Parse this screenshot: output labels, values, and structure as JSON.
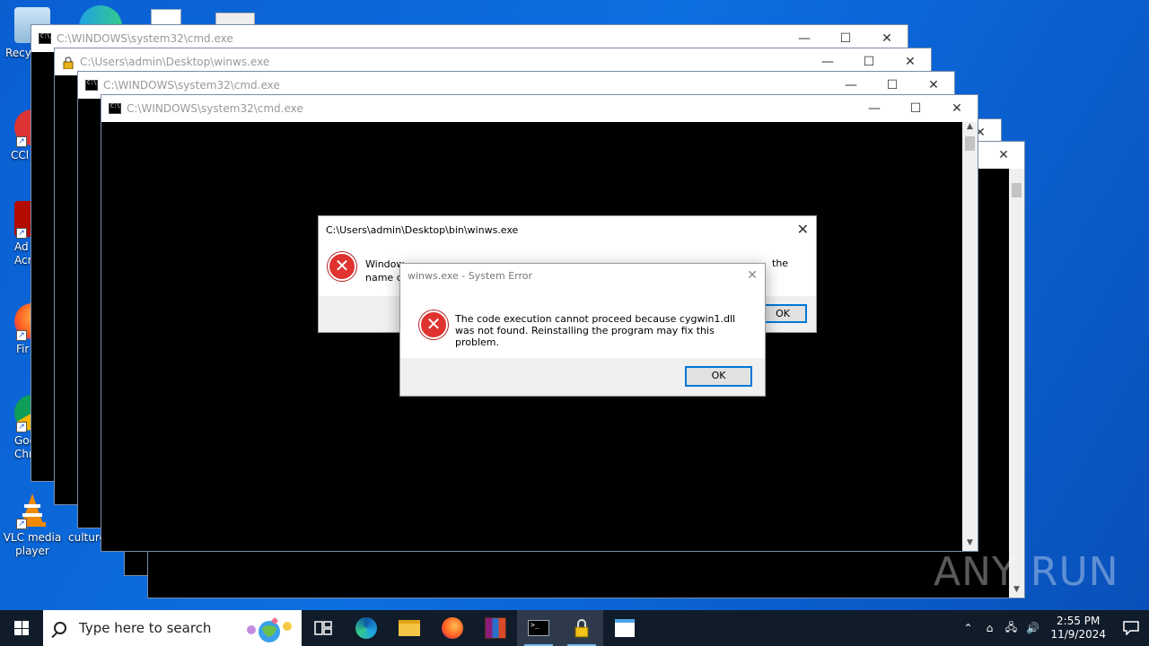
{
  "desktop": {
    "icons": [
      {
        "label": "Recy"
      },
      {
        "label": "CCl"
      },
      {
        "label": "Ad Acr"
      },
      {
        "label": "Fir"
      },
      {
        "label": "Goo Chr"
      },
      {
        "label": "VLC media player"
      },
      {
        "label": "culture"
      }
    ]
  },
  "windows": [
    {
      "title": "C:\\WINDOWS\\system32\\cmd.exe"
    },
    {
      "title": "C:\\Users\\admin\\Desktop\\winws.exe"
    },
    {
      "title": "C:\\WINDOWS\\system32\\cmd.exe"
    },
    {
      "title": "C:\\WINDOWS\\system32\\cmd.exe"
    }
  ],
  "controls": {
    "minimize": "—",
    "maximize": "☐",
    "close": "✕"
  },
  "dialog_back": {
    "title": "C:\\Users\\admin\\Desktop\\bin\\winws.exe",
    "message_line1": "Window",
    "message_line1_end": "the",
    "message_line2": "name c",
    "ok": "OK"
  },
  "dialog_front": {
    "title": "winws.exe - System Error",
    "message": "The code execution cannot proceed because cygwin1.dll was not found. Reinstalling the program may fix this problem.",
    "ok": "OK"
  },
  "watermark": "ANY RUN",
  "taskbar": {
    "search_placeholder": "Type here to search",
    "time": "2:55 PM",
    "date": "11/9/2024"
  },
  "colors": {
    "accent": "#0078d7",
    "error": "#e0322f",
    "taskbar": "#111c2b"
  }
}
